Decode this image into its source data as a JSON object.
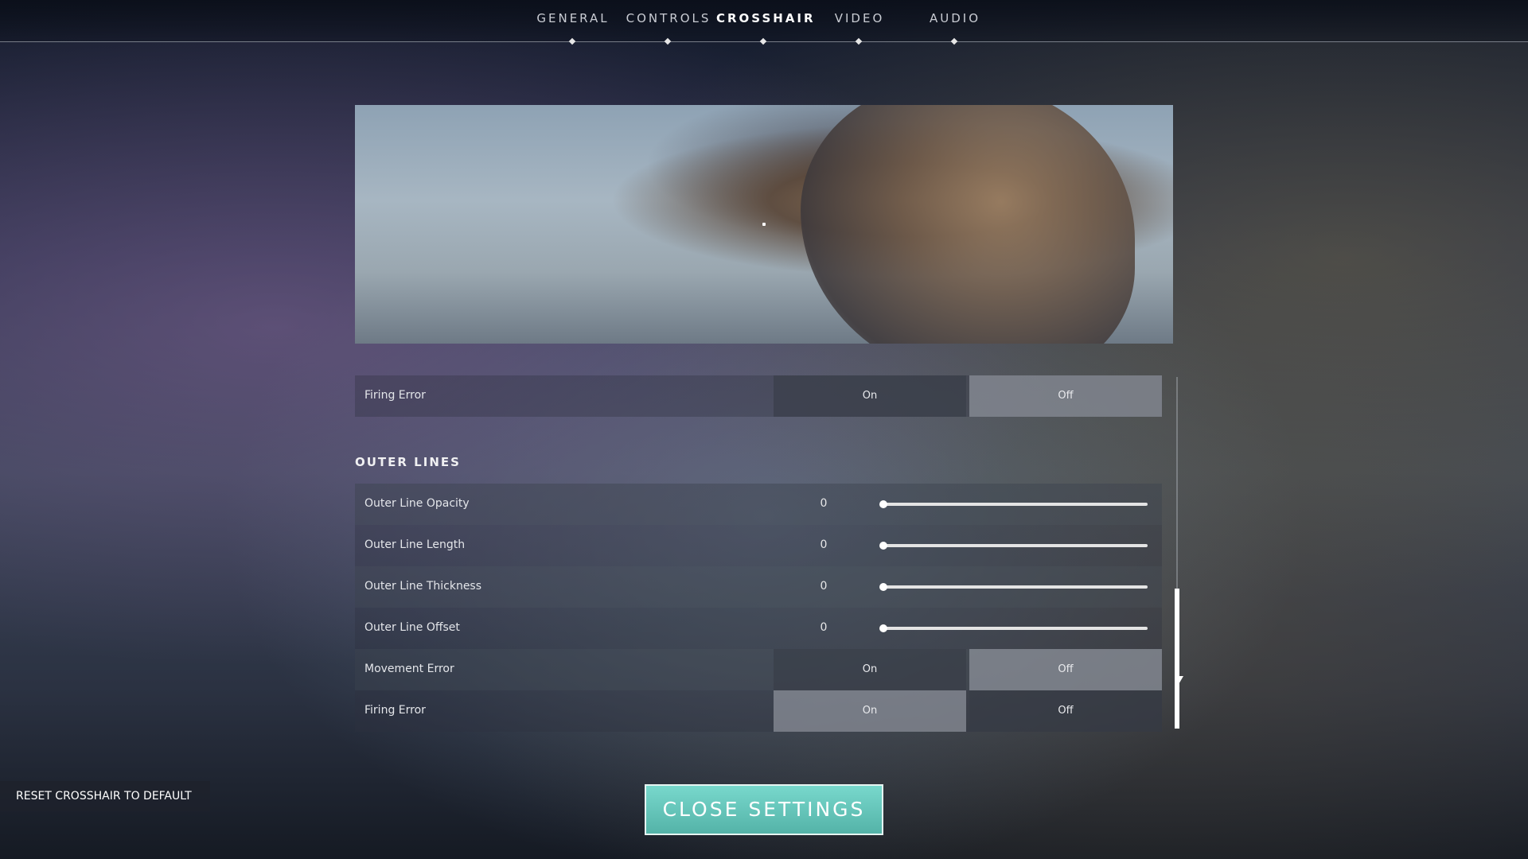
{
  "nav": {
    "tabs": [
      {
        "label": "GENERAL"
      },
      {
        "label": "CONTROLS"
      },
      {
        "label": "CROSSHAIR"
      },
      {
        "label": "VIDEO"
      },
      {
        "label": "AUDIO"
      }
    ],
    "active": "CROSSHAIR"
  },
  "settings": {
    "firing_error_top": {
      "label": "Firing Error",
      "on": "On",
      "off": "Off",
      "selected": "Off"
    },
    "section_title": "OUTER LINES",
    "sliders": [
      {
        "label": "Outer Line Opacity",
        "value": "0",
        "fraction": 0
      },
      {
        "label": "Outer Line Length",
        "value": "0",
        "fraction": 0
      },
      {
        "label": "Outer Line Thickness",
        "value": "0",
        "fraction": 0
      },
      {
        "label": "Outer Line Offset",
        "value": "0",
        "fraction": 0
      }
    ],
    "movement_error": {
      "label": "Movement Error",
      "on": "On",
      "off": "Off",
      "selected": "Off"
    },
    "firing_error": {
      "label": "Firing Error",
      "on": "On",
      "off": "Off",
      "selected": "On"
    }
  },
  "buttons": {
    "reset": "RESET CROSSHAIR TO DEFAULT",
    "close": "CLOSE SETTINGS"
  },
  "colors": {
    "accent": "#5fc2b6",
    "selected_toggle": "#9a9ea7"
  }
}
